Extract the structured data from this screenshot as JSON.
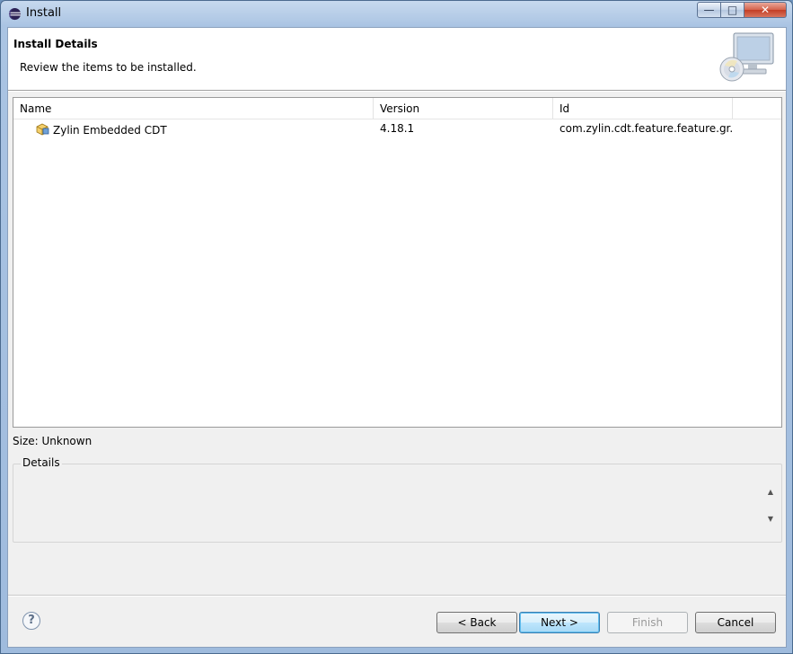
{
  "window": {
    "title": "Install"
  },
  "header": {
    "title": "Install Details",
    "description": "Review the items to be installed."
  },
  "table": {
    "columns": [
      "Name",
      "Version",
      "Id"
    ],
    "rows": [
      {
        "name": "Zylin Embedded CDT",
        "version": "4.18.1",
        "id": "com.zylin.cdt.feature.feature.gr..."
      }
    ]
  },
  "size": "Size: Unknown",
  "details": {
    "label": "Details"
  },
  "buttons": {
    "help": "?",
    "back": "< Back",
    "next": "Next >",
    "finish": "Finish",
    "cancel": "Cancel"
  },
  "icons": {
    "app": "eclipse-icon",
    "feature": "feature-plugin-icon",
    "banner": "install-computer-cd-icon",
    "help": "help-icon"
  }
}
